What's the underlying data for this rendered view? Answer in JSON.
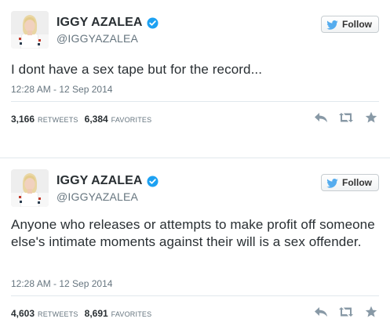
{
  "colors": {
    "text": "#292f33",
    "muted": "#66757f",
    "verified": "#1da1f2",
    "twitter_blue": "#55acee",
    "action_gray": "#8899a6"
  },
  "tweets": [
    {
      "display_name": "IGGY AZALEA",
      "handle": "@IGGYAZALEA",
      "follow_label": "Follow",
      "text": "I dont have a sex tape but for the record...",
      "timestamp": "12:28 AM - 12 Sep 2014",
      "retweets_count": "3,166",
      "retweets_label": "RETWEETS",
      "favorites_count": "6,384",
      "favorites_label": "FAVORITES",
      "icons": [
        "verified-badge-icon",
        "twitter-bird-icon",
        "reply-icon",
        "retweet-icon",
        "favorite-star-icon"
      ]
    },
    {
      "display_name": "IGGY AZALEA",
      "handle": "@IGGYAZALEA",
      "follow_label": "Follow",
      "text": "Anyone who releases or attempts to make profit off someone else's intimate moments against their will is a sex offender.",
      "timestamp": "12:28 AM - 12 Sep 2014",
      "retweets_count": "4,603",
      "retweets_label": "RETWEETS",
      "favorites_count": "8,691",
      "favorites_label": "FAVORITES",
      "icons": [
        "verified-badge-icon",
        "twitter-bird-icon",
        "reply-icon",
        "retweet-icon",
        "favorite-star-icon"
      ]
    }
  ]
}
